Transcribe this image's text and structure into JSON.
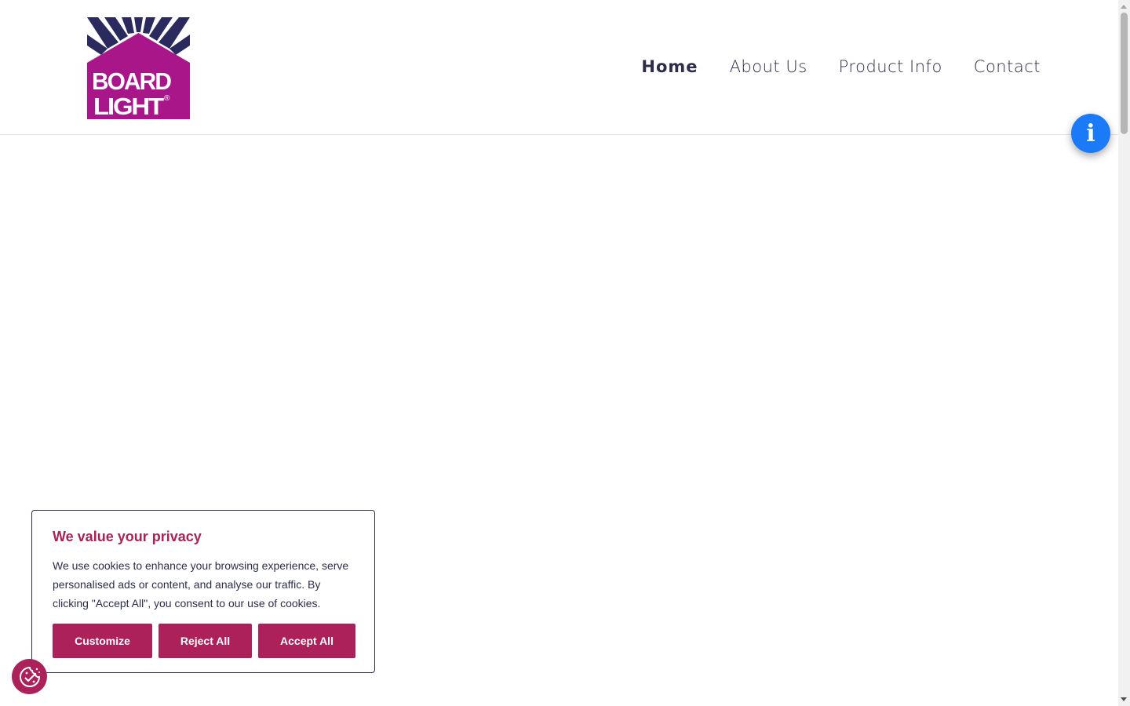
{
  "header": {
    "logo": {
      "line1": "BOARD",
      "line2": "LIGHT",
      "registered": "®",
      "colors": {
        "house": "#a8168a",
        "rays": "#2a2a5e",
        "text": "#ffffff"
      }
    },
    "nav": [
      {
        "label": "Home",
        "active": true
      },
      {
        "label": "About Us",
        "active": false
      },
      {
        "label": "Product Info",
        "active": false
      },
      {
        "label": "Contact",
        "active": false
      }
    ]
  },
  "info_button": {
    "icon": "info-icon",
    "glyph": "i",
    "color": "#1a7af8"
  },
  "cookie_banner": {
    "title": "We value your privacy",
    "text": "We use cookies to enhance your browsing experience, serve personalised ads or content, and analyse our traffic. By clicking \"Accept All\", you consent to our use of cookies.",
    "buttons": {
      "customize": "Customize",
      "reject": "Reject All",
      "accept": "Accept All"
    },
    "accent_color": "#ac2159"
  },
  "cookie_revisit": {
    "icon": "cookie-settings-icon"
  }
}
